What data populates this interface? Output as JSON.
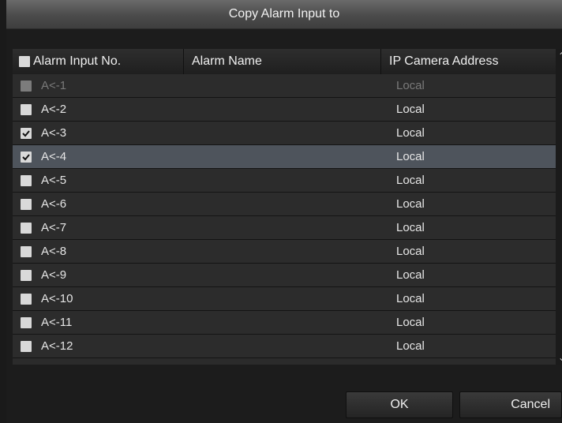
{
  "dialog": {
    "title": "Copy Alarm Input to"
  },
  "table": {
    "headers": {
      "alarm_input_no": "Alarm Input No.",
      "alarm_name": "Alarm Name",
      "ip_camera_address": "IP Camera Address"
    },
    "rows": [
      {
        "input": "A<-1",
        "name": "",
        "address": "Local",
        "checked": false,
        "disabled": true,
        "selected": false
      },
      {
        "input": "A<-2",
        "name": "",
        "address": "Local",
        "checked": false,
        "disabled": false,
        "selected": false
      },
      {
        "input": "A<-3",
        "name": "",
        "address": "Local",
        "checked": true,
        "disabled": false,
        "selected": false
      },
      {
        "input": "A<-4",
        "name": "",
        "address": "Local",
        "checked": true,
        "disabled": false,
        "selected": true
      },
      {
        "input": "A<-5",
        "name": "",
        "address": "Local",
        "checked": false,
        "disabled": false,
        "selected": false
      },
      {
        "input": "A<-6",
        "name": "",
        "address": "Local",
        "checked": false,
        "disabled": false,
        "selected": false
      },
      {
        "input": "A<-7",
        "name": "",
        "address": "Local",
        "checked": false,
        "disabled": false,
        "selected": false
      },
      {
        "input": "A<-8",
        "name": "",
        "address": "Local",
        "checked": false,
        "disabled": false,
        "selected": false
      },
      {
        "input": "A<-9",
        "name": "",
        "address": "Local",
        "checked": false,
        "disabled": false,
        "selected": false
      },
      {
        "input": "A<-10",
        "name": "",
        "address": "Local",
        "checked": false,
        "disabled": false,
        "selected": false
      },
      {
        "input": "A<-11",
        "name": "",
        "address": "Local",
        "checked": false,
        "disabled": false,
        "selected": false
      },
      {
        "input": "A<-12",
        "name": "",
        "address": "Local",
        "checked": false,
        "disabled": false,
        "selected": false
      }
    ]
  },
  "buttons": {
    "ok": "OK",
    "cancel": "Cancel"
  },
  "icons": {
    "scroll_up": "chevron-up-icon",
    "scroll_down": "chevron-down-icon",
    "check": "checkmark-icon"
  },
  "colors": {
    "selected_row": "#4e545c",
    "row": "#2c2c2c",
    "title_bar": "#5a5a5a"
  }
}
